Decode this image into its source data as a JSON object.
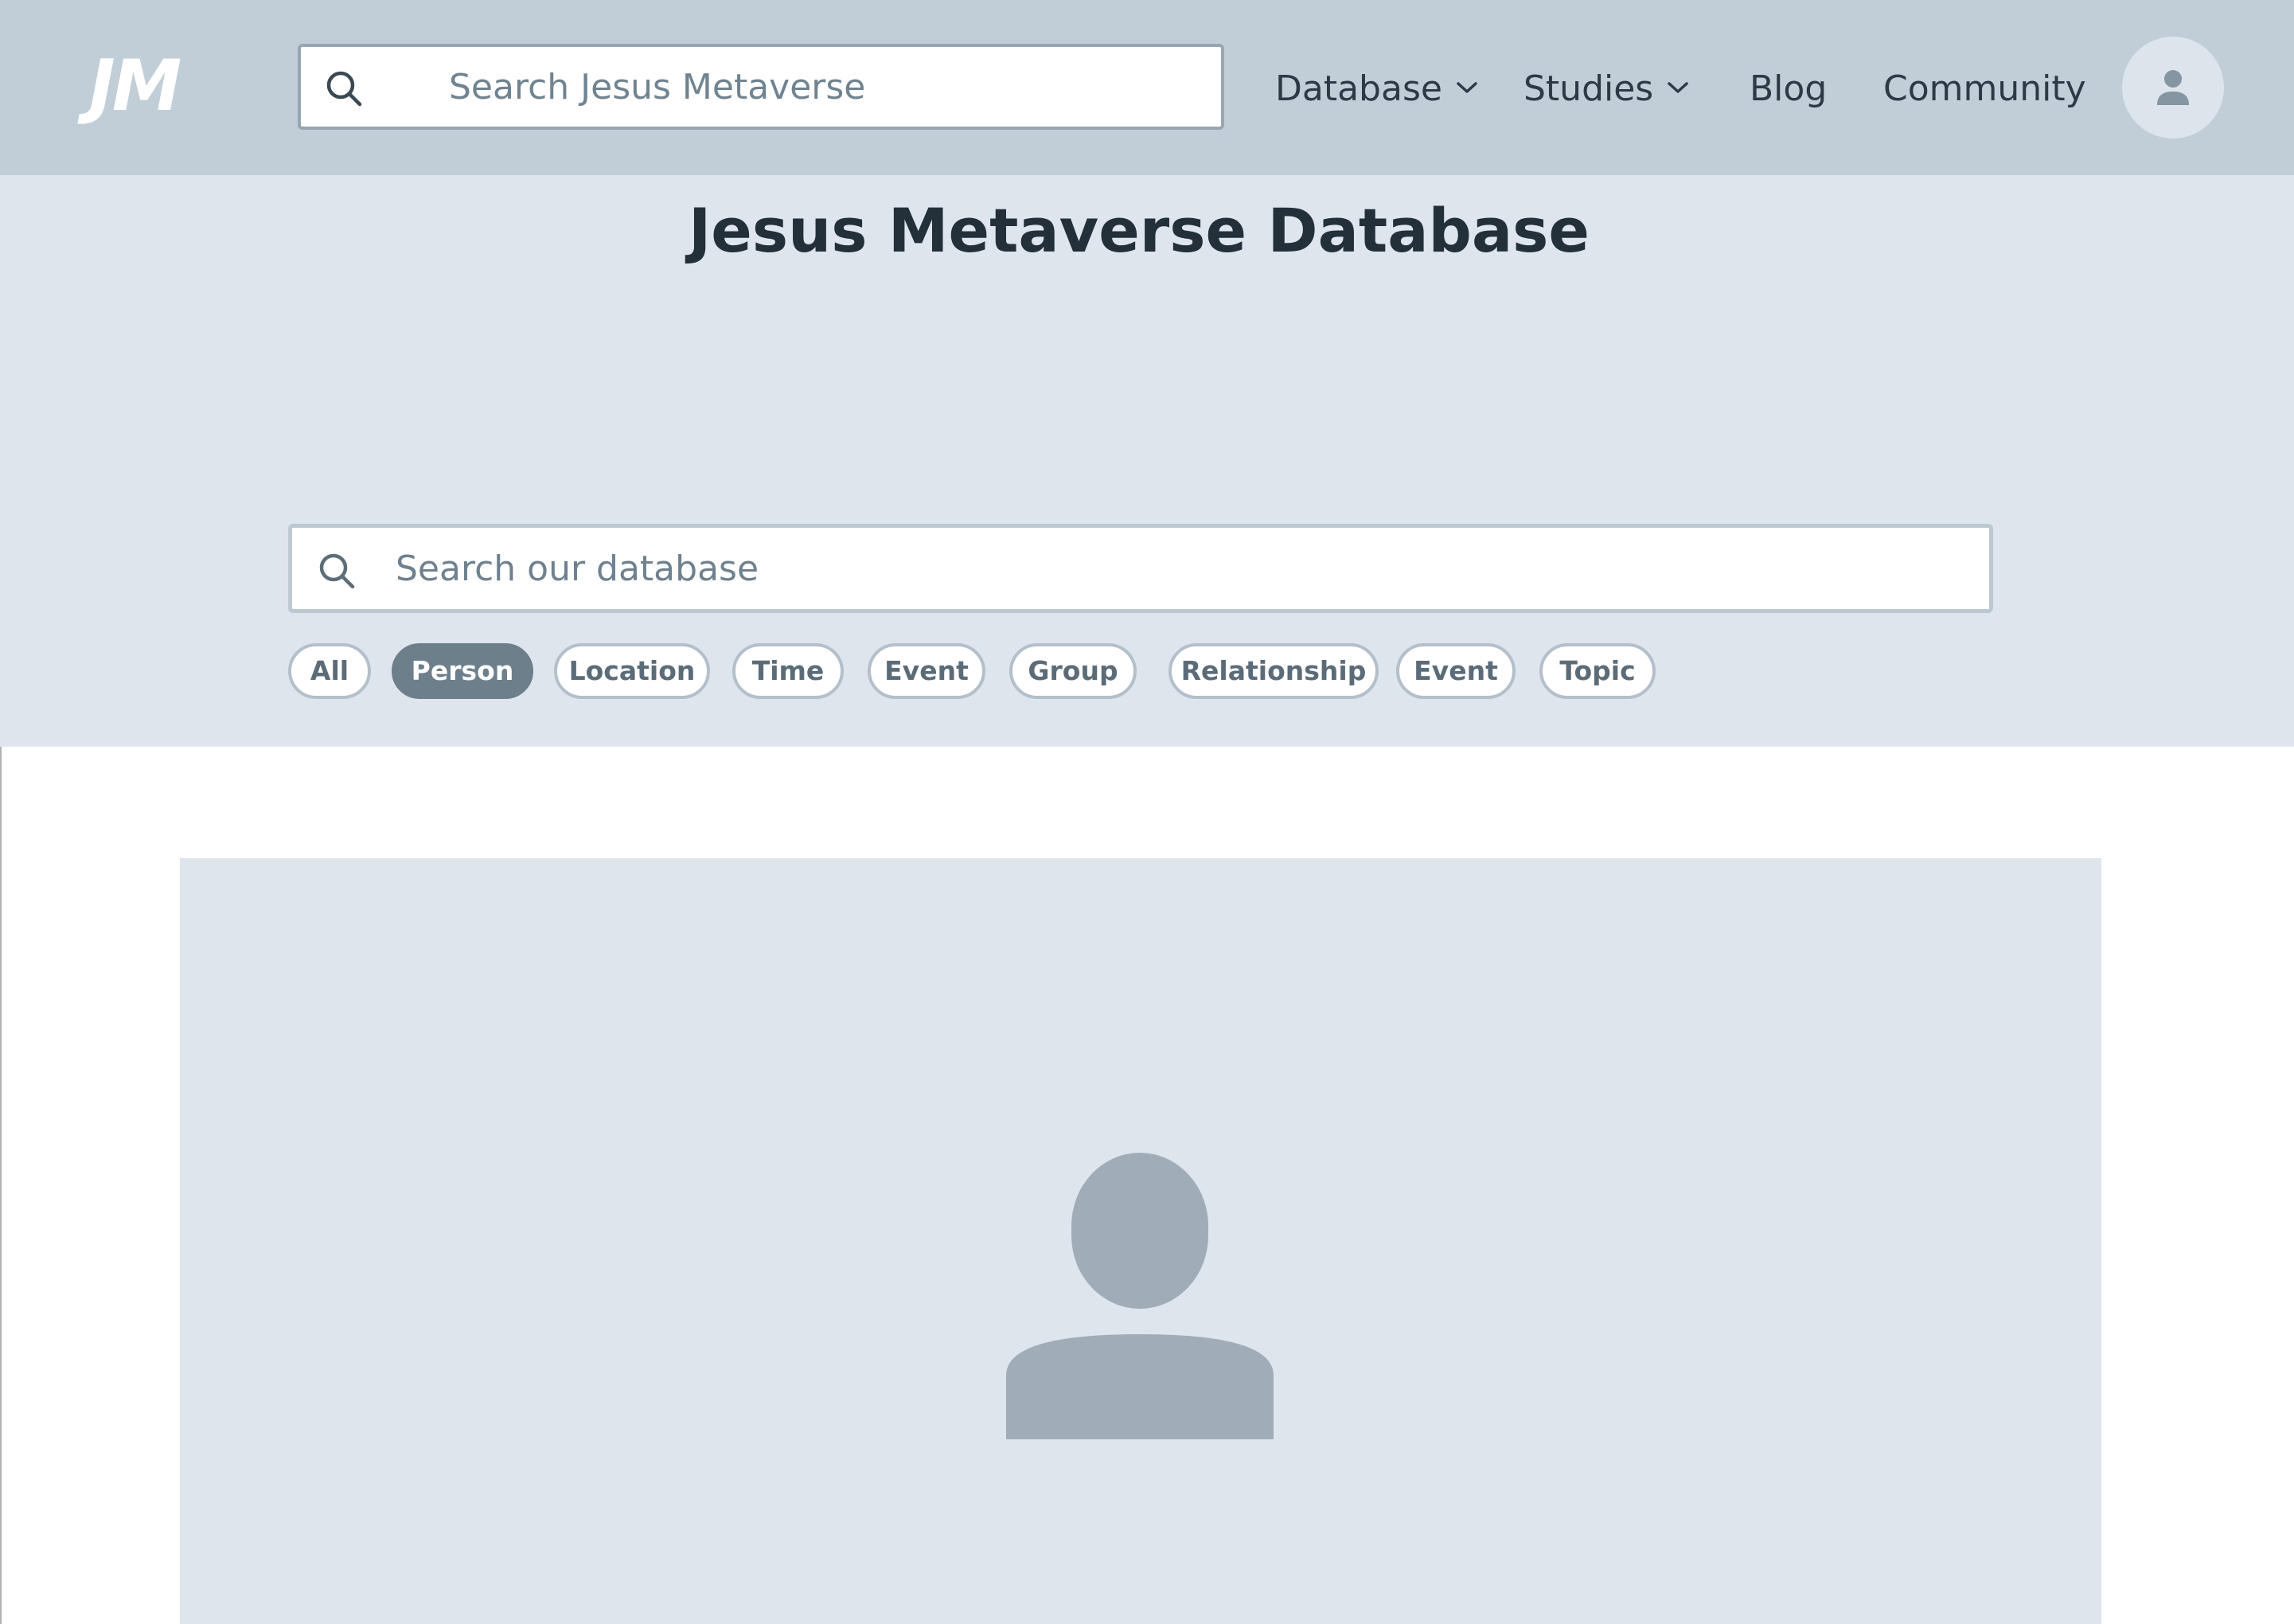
{
  "header": {
    "logo_text": "JM",
    "search_placeholder": "Search Jesus Metaverse",
    "nav": [
      {
        "label": "Database",
        "has_dropdown": true
      },
      {
        "label": "Studies",
        "has_dropdown": true
      },
      {
        "label": "Blog",
        "has_dropdown": false
      },
      {
        "label": "Community",
        "has_dropdown": false
      }
    ],
    "account_icon": "user-icon"
  },
  "hero": {
    "title": "Jesus Metaverse Database",
    "search_placeholder": "Search our database",
    "filters": [
      {
        "label": "All",
        "active": false
      },
      {
        "label": "Person",
        "active": true
      },
      {
        "label": "Location",
        "active": false
      },
      {
        "label": "Time",
        "active": false
      },
      {
        "label": "Event",
        "active": false
      },
      {
        "label": "Group",
        "active": false
      },
      {
        "label": "Relationship",
        "active": false
      },
      {
        "label": "Event",
        "active": false
      },
      {
        "label": "Topic",
        "active": false
      }
    ]
  },
  "card": {
    "image_icon": "person-placeholder-icon"
  },
  "colors": {
    "header_bg": "#c1ced8",
    "hero_bg": "#dfe5ed",
    "title_text": "#232f39",
    "nav_text": "#2d3a45",
    "chip_active_bg": "#6e7f8c",
    "chip_border": "#b3c0cb",
    "placeholder_icon": "#a0adb9"
  }
}
